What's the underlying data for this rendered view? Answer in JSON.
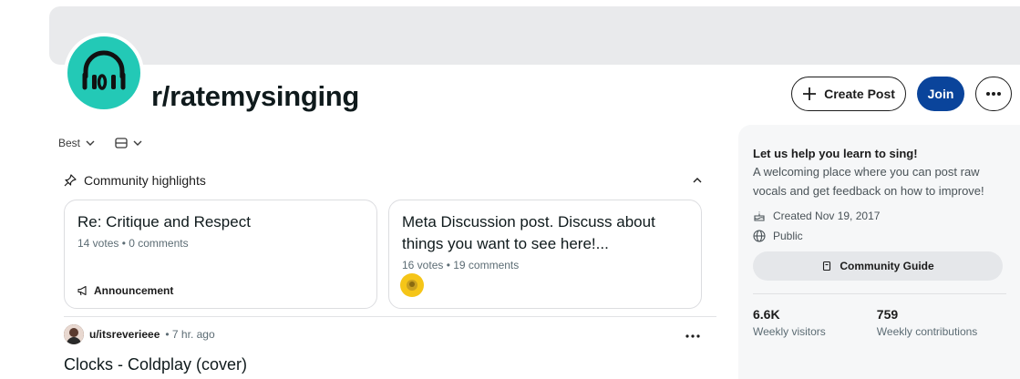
{
  "community": {
    "name": "r/ratemysinging",
    "accent_color": "#23c9b6"
  },
  "actions": {
    "create_post_label": "Create Post",
    "join_label": "Join",
    "more_icon": "ellipsis-icon"
  },
  "sort": {
    "selected": "Best",
    "view_icon": "layout-icon"
  },
  "highlights": {
    "header": "Community highlights",
    "cards": [
      {
        "title": "Re: Critique and Respect",
        "meta": "14 votes • 0 comments",
        "tag": "Announcement"
      },
      {
        "title": "Meta Discussion post. Discuss about things you want to see here!...",
        "meta": "16 votes • 19 comments"
      }
    ]
  },
  "post": {
    "user": "u/itsreverieee",
    "time": "• 7 hr. ago",
    "title": "Clocks - Coldplay (cover)"
  },
  "sidebar": {
    "title": "Let us help you learn to sing!",
    "description": "A welcoming place where you can post raw vocals and get feedback on how to improve!",
    "created": "Created Nov 19, 2017",
    "visibility": "Public",
    "guide_label": "Community Guide",
    "stats": [
      {
        "value": "6.6K",
        "label": "Weekly visitors"
      },
      {
        "value": "759",
        "label": "Weekly contributions"
      }
    ]
  },
  "colors": {
    "join_button": "#0a449b",
    "banner": "#e9eaec",
    "sidebar_bg": "#f6f7f8"
  }
}
